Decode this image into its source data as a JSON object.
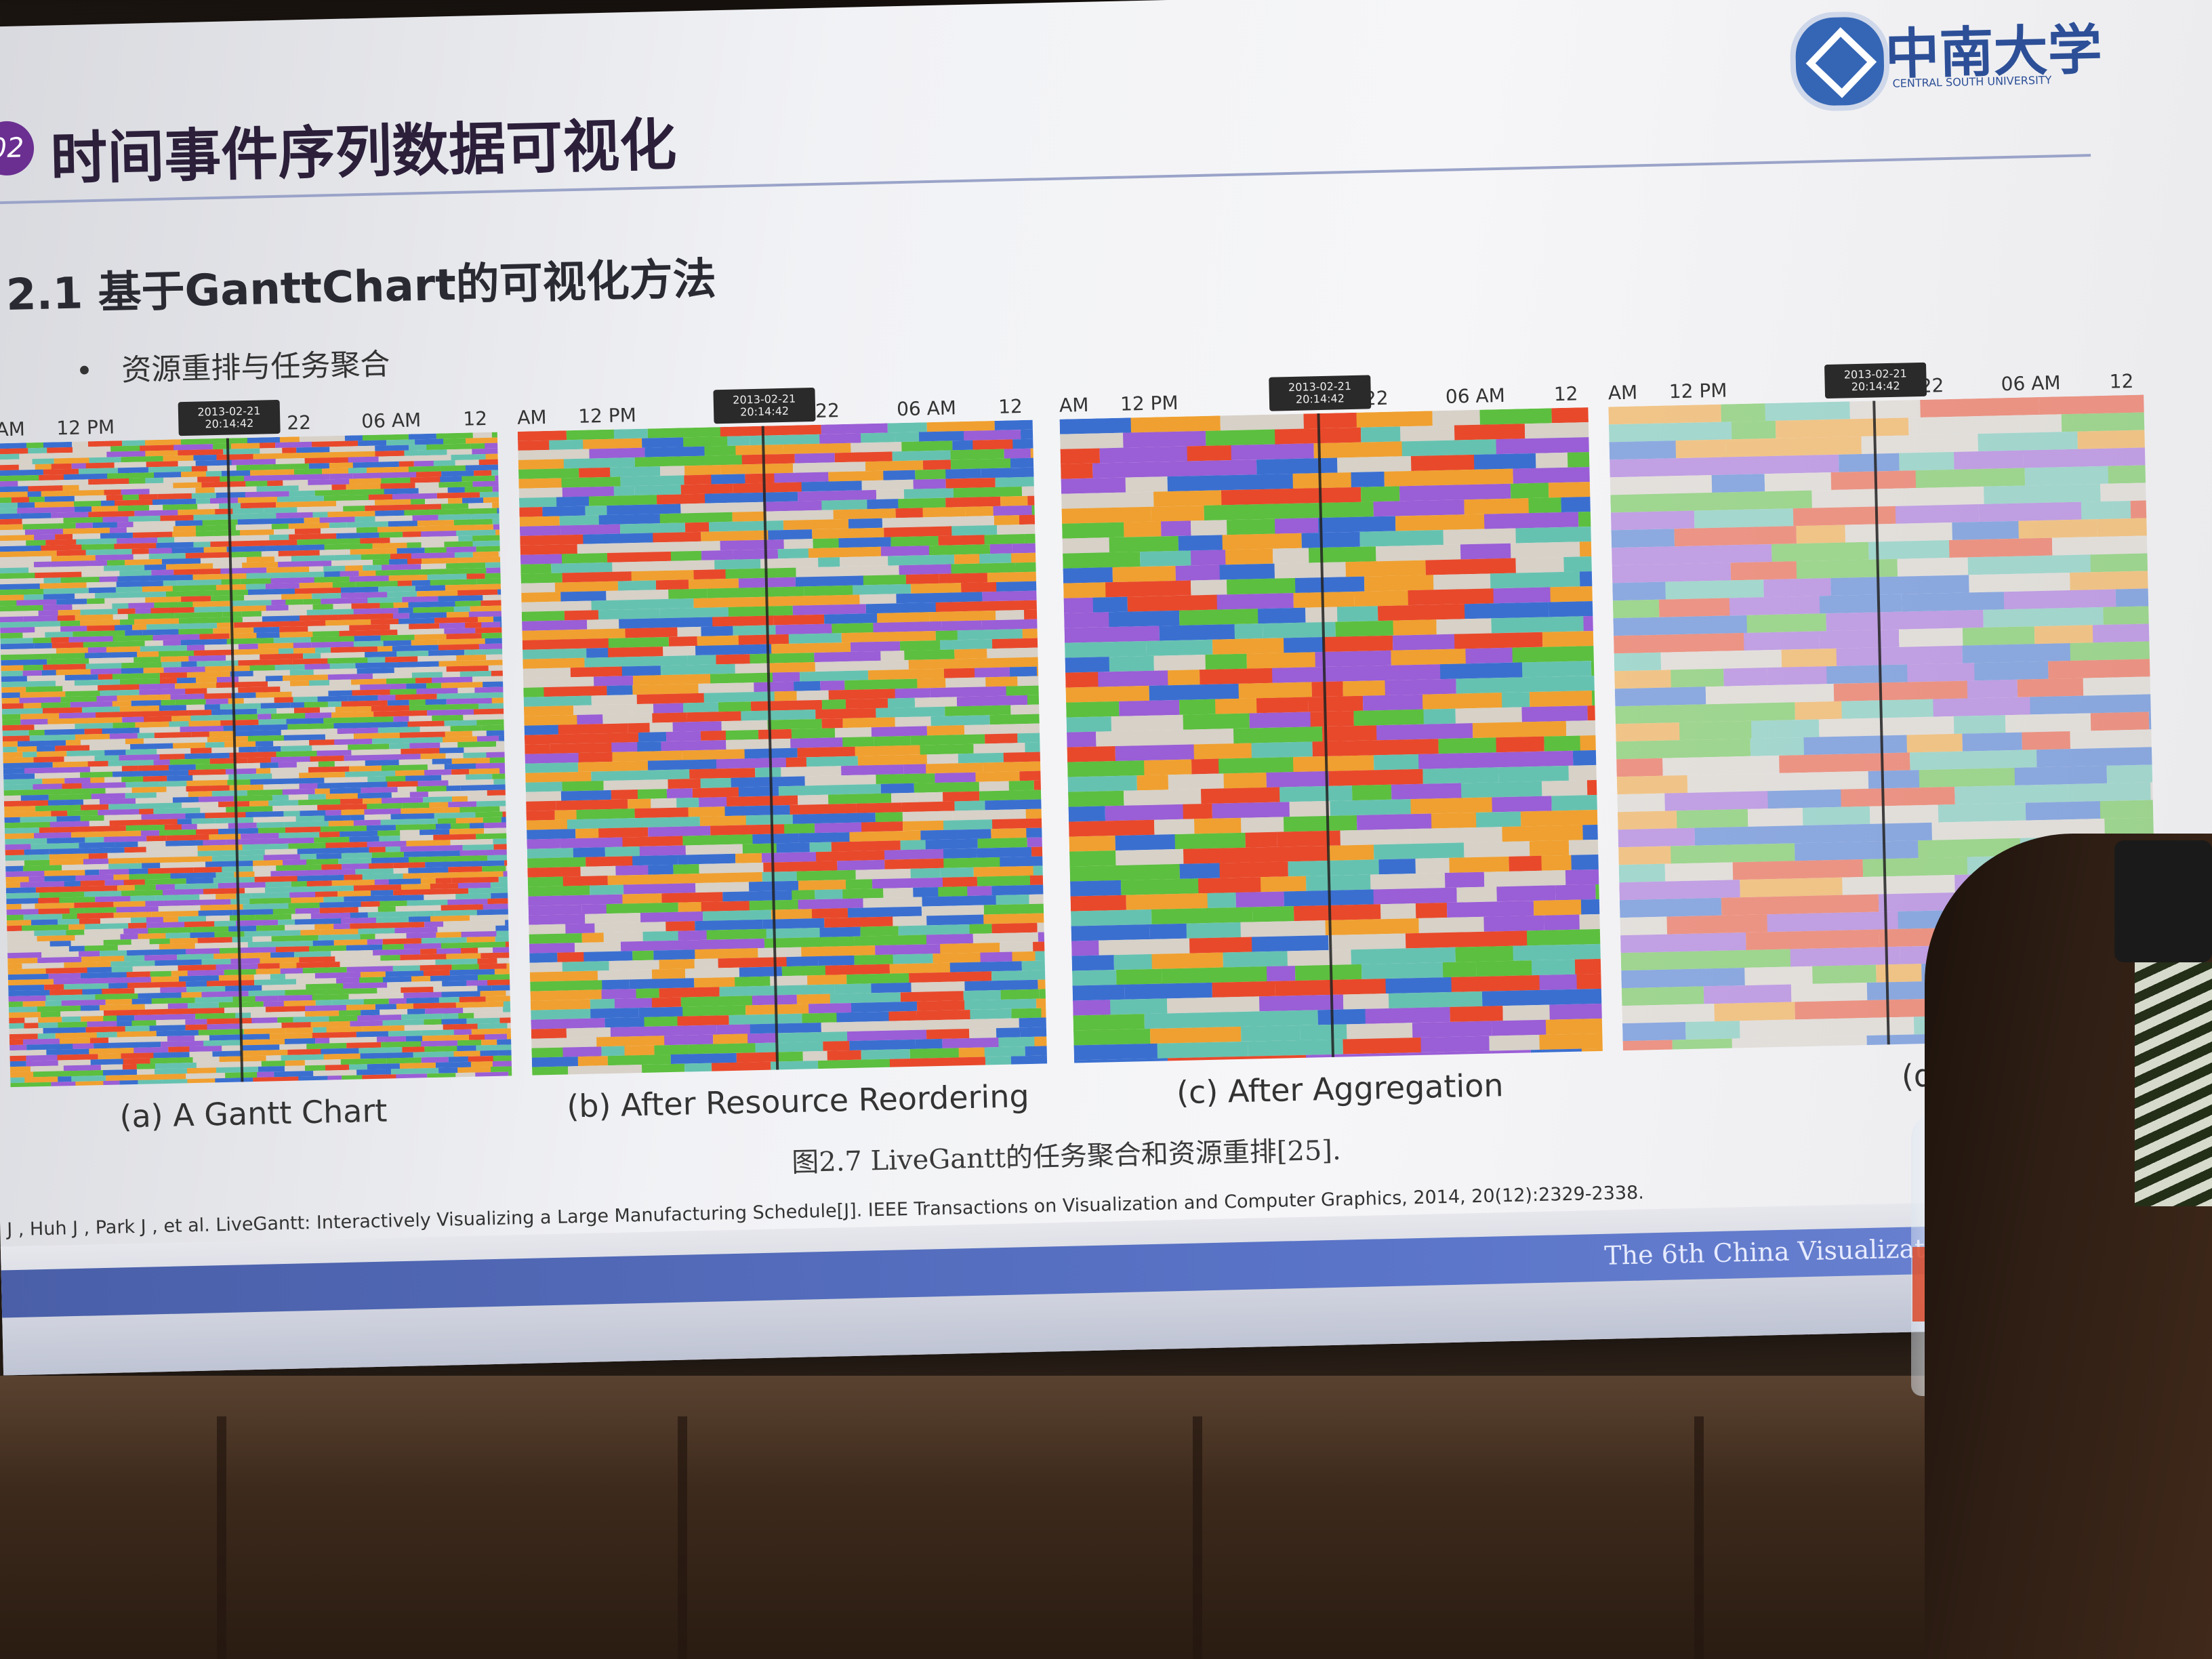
{
  "slide": {
    "section_number": "02",
    "title": "时间事件序列数据可视化",
    "university_name": "中南大学",
    "university_english": "CENTRAL SOUTH UNIVERSITY",
    "subtitle": "2.1 基于GanttChart的可视化方法",
    "bullet": "资源重排与任务聚合",
    "axis_ticks": [
      "AM",
      "12 PM",
      "22",
      "06 AM",
      "12"
    ],
    "tooltip": [
      "2013-02-21",
      "20:14:42"
    ],
    "figure_labels": {
      "a": "(a) A Gantt Chart",
      "b": "(b) After Resource Reordering",
      "c": "(c) After Aggregation",
      "d": "(d)"
    },
    "caption": "图2.7 LiveGantt的任务聚合和资源重排[25].",
    "reference": "J , Huh J , Park J , et al. LiveGantt: Interactively Visualizing a Large Manufacturing Schedule[J]. IEEE Transactions on Visualization and Computer Graphics, 2014, 20(12):2329-2338.",
    "footer": "The 6th China Visualization and Visual Analytics"
  },
  "colors": {
    "title_purple": "#6a2f91",
    "footer_blue": "#5a74c8",
    "task_orange": "#f0a030",
    "task_green": "#5cbf3f",
    "task_red": "#e8492b",
    "task_blue": "#3a6fd0",
    "task_purple": "#9a5ed6",
    "task_teal": "#66c2b0"
  }
}
